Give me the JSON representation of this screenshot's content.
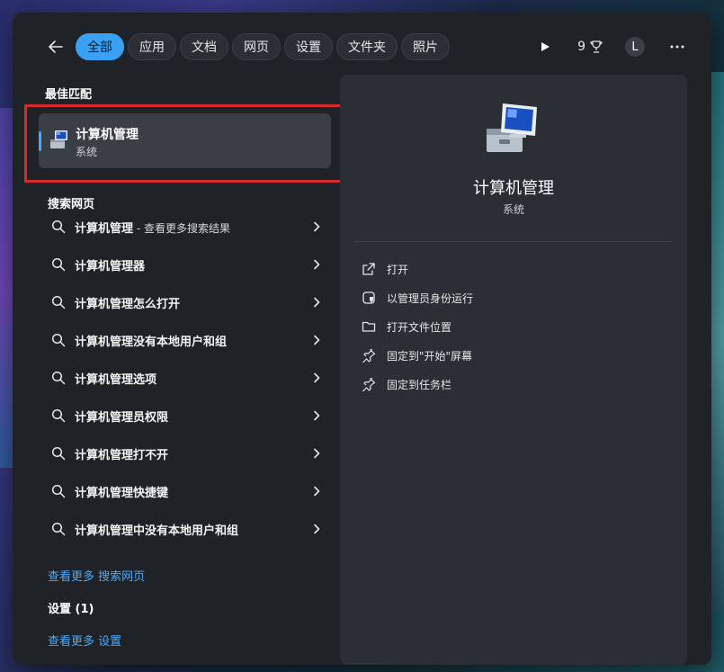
{
  "colors": {
    "accent": "#3aa0f3",
    "highlight": "#d42b2b",
    "panel": "#1f2328",
    "card": "#3a3e45"
  },
  "tabs": [
    {
      "label": "全部",
      "active": true
    },
    {
      "label": "应用"
    },
    {
      "label": "文档"
    },
    {
      "label": "网页"
    },
    {
      "label": "设置"
    },
    {
      "label": "文件夹"
    },
    {
      "label": "照片"
    }
  ],
  "top_right": {
    "rewards_count": "9",
    "avatar_letter": "L"
  },
  "best_match": {
    "section_title": "最佳匹配",
    "title": "计算机管理",
    "subtitle": "系统",
    "icon": "computer-management-icon"
  },
  "web_search": {
    "section_title": "搜索网页",
    "items": [
      {
        "text": "计算机管理",
        "suffix": " - 查看更多搜索结果"
      },
      {
        "text": "计算机管理器",
        "suffix": ""
      },
      {
        "text": "计算机管理怎么打开",
        "suffix": ""
      },
      {
        "text": "计算机管理没有本地用户和组",
        "suffix": ""
      },
      {
        "text": "计算机管理选项",
        "suffix": ""
      },
      {
        "text": "计算机管理员权限",
        "suffix": ""
      },
      {
        "text": "计算机管理打不开",
        "suffix": ""
      },
      {
        "text": "计算机管理快捷键",
        "suffix": ""
      },
      {
        "text": "计算机管理中没有本地用户和组",
        "suffix": ""
      }
    ],
    "more_link": "查看更多 搜索网页"
  },
  "settings": {
    "section_title": "设置 (1)",
    "more_link": "查看更多 设置"
  },
  "detail": {
    "title": "计算机管理",
    "subtitle": "系统",
    "actions": [
      {
        "label": "打开",
        "icon": "open-external-icon"
      },
      {
        "label": "以管理员身份运行",
        "icon": "shield-admin-icon"
      },
      {
        "label": "打开文件位置",
        "icon": "folder-icon"
      },
      {
        "label": "固定到\"开始\"屏幕",
        "icon": "pin-icon"
      },
      {
        "label": "固定到任务栏",
        "icon": "pin-icon"
      }
    ]
  }
}
